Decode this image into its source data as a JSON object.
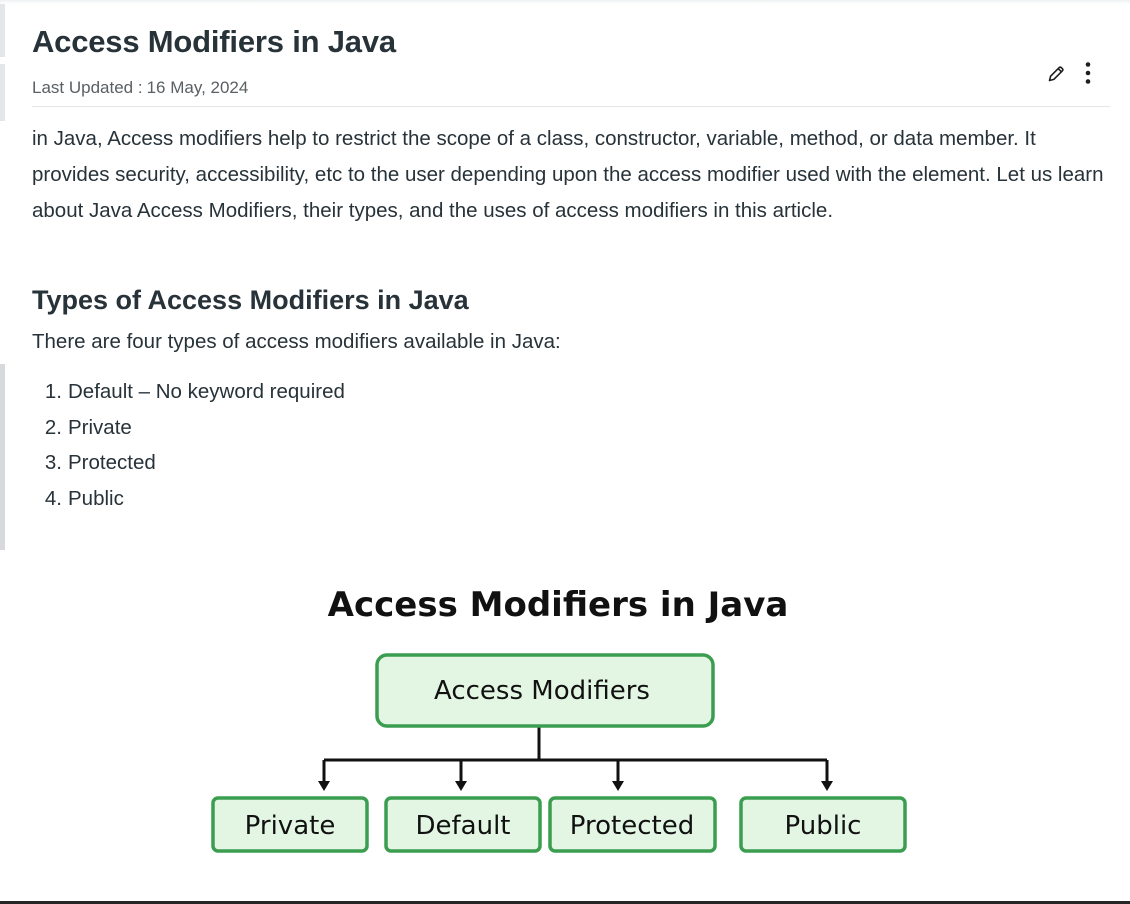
{
  "article": {
    "title": "Access Modifiers in Java",
    "last_updated_label": "Last Updated :",
    "last_updated_date": "16 May, 2024",
    "actions": {
      "edit_icon": "pencil-icon",
      "more_icon": "kebab-menu-icon"
    },
    "intro": "in Java, Access modifiers help to restrict the scope of a class, constructor, variable, method, or data member. It provides security, accessibility, etc to the user depending upon the access modifier used with the element. Let us learn about Java Access Modifiers, their types, and the uses of access modifiers in this article.",
    "section": {
      "heading": "Types of Access Modifiers in Java",
      "lead": "There are four types of access modifiers available in Java:",
      "items": [
        {
          "num": "1",
          "text": "Default – No keyword required"
        },
        {
          "num": "2",
          "text": "Private"
        },
        {
          "num": "3",
          "text": "Protected"
        },
        {
          "num": "4",
          "text": "Public"
        }
      ]
    },
    "diagram": {
      "title": "Access Modifiers in Java",
      "root": "Access Modifiers",
      "children": [
        "Private",
        "Default",
        "Protected",
        "Public"
      ],
      "colors": {
        "box_border": "#3a9d4f",
        "box_fill": "#e3f6e3",
        "connector": "#111111",
        "text": "#111111"
      }
    }
  }
}
